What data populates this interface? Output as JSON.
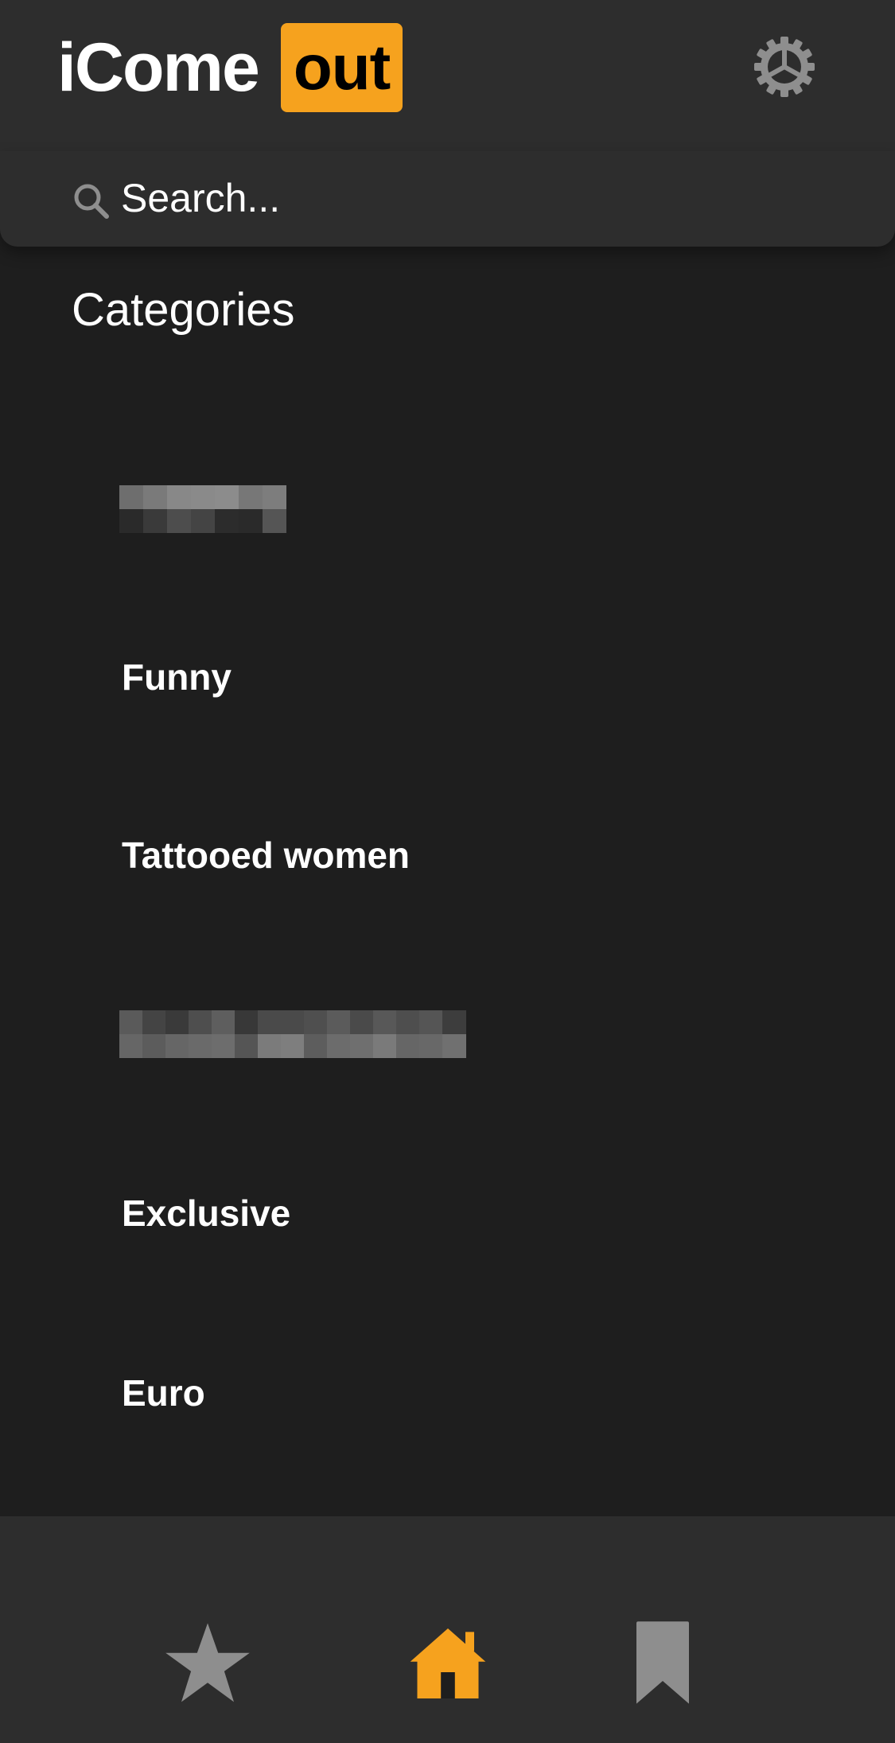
{
  "header": {
    "logo_text": "iCome",
    "logo_badge": "out",
    "settings_icon": "gear-icon"
  },
  "search": {
    "placeholder": "Search...",
    "icon": "search-icon"
  },
  "section": {
    "title": "Categories"
  },
  "categories": {
    "items": [
      {
        "label": "",
        "obscured": true
      },
      {
        "label": "Funny"
      },
      {
        "label": "Tattooed women"
      },
      {
        "label": "",
        "obscured": true
      },
      {
        "label": "Exclusive"
      },
      {
        "label": "Euro"
      }
    ]
  },
  "tabbar": {
    "tabs": [
      {
        "icon": "star-icon",
        "active": false
      },
      {
        "icon": "home-icon",
        "active": true
      },
      {
        "icon": "bookmark-icon",
        "active": false
      }
    ]
  },
  "colors": {
    "accent": "#f6a21e",
    "background": "#1e1e1e",
    "bar": "#2d2d2d",
    "inactive_icon": "#8e8e8e"
  }
}
